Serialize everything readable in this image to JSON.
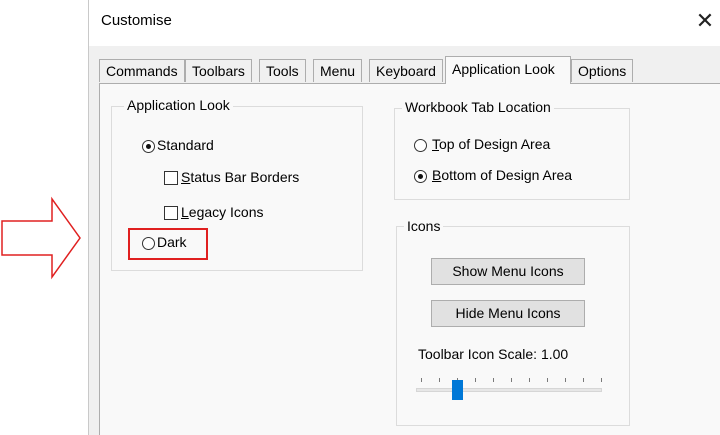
{
  "dialog": {
    "title": "Customise",
    "close_glyph": "✕"
  },
  "tabs": [
    {
      "label": "Commands"
    },
    {
      "label": "Toolbars"
    },
    {
      "label": "Tools"
    },
    {
      "label": "Menu"
    },
    {
      "label": "Keyboard"
    },
    {
      "label": "Application Look",
      "active": true
    },
    {
      "label": "Options"
    }
  ],
  "application_look": {
    "group_label": "Application Look",
    "standard_label": "Standard",
    "standard_selected": true,
    "status_bar_borders_label": "Status Bar Borders",
    "status_bar_borders_checked": false,
    "legacy_icons_label": "Legacy Icons",
    "legacy_icons_checked": false,
    "dark_label": "Dark",
    "dark_selected": false
  },
  "workbook_tab_location": {
    "group_label": "Workbook Tab Location",
    "top_label": "Top of Design Area",
    "top_selected": false,
    "bottom_label": "Bottom of Design Area",
    "bottom_selected": true
  },
  "icons": {
    "group_label": "Icons",
    "show_button": "Show Menu Icons",
    "hide_button": "Hide Menu Icons",
    "scale_label": "Toolbar Icon Scale: 1.00",
    "scale_value": 1.0,
    "slider_tick_count": 11,
    "slider_position_index": 2
  },
  "annotation": {
    "arrow_color": "#e02020",
    "highlight_color": "#e02020"
  },
  "colors": {
    "accent": "#0078d7"
  }
}
